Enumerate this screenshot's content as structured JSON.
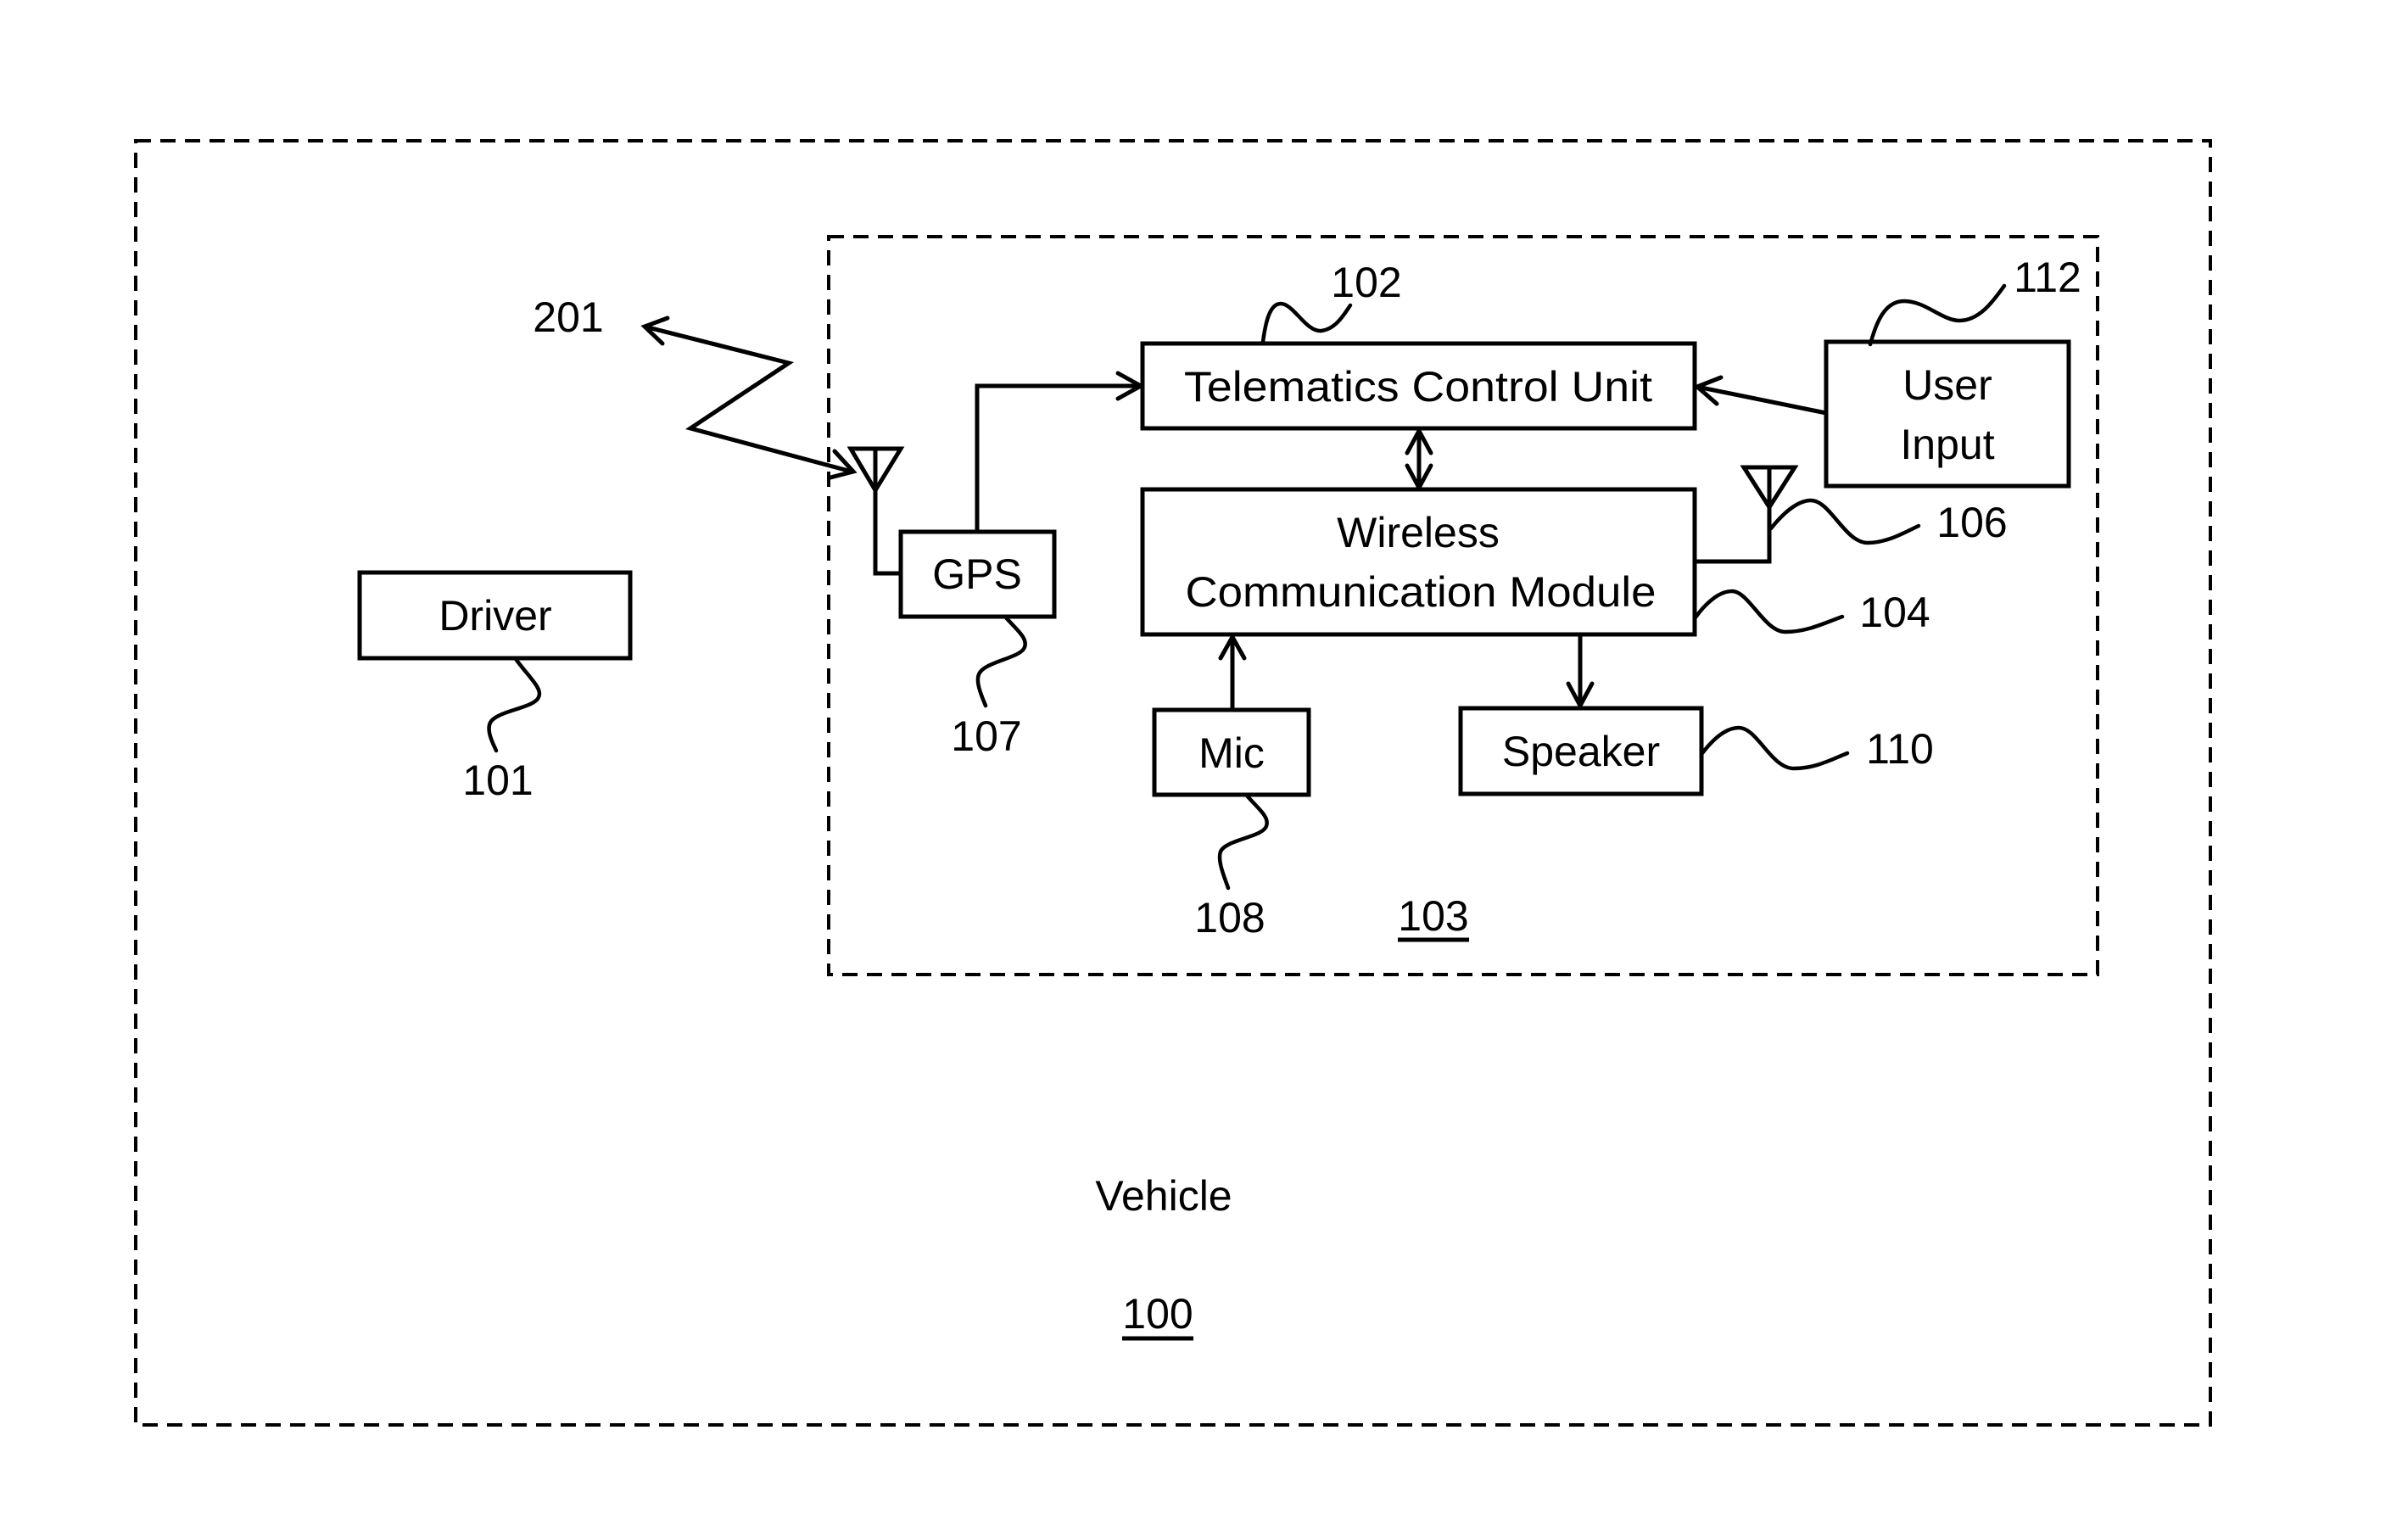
{
  "figure": {
    "type": "patent block diagram",
    "colors": {
      "line": "#000000",
      "background": "#ffffff"
    }
  },
  "containers": {
    "vehicle": {
      "label": "Vehicle",
      "ref": "100",
      "ref_underlined": true
    },
    "telematics_system": {
      "ref": "103",
      "ref_underlined": true
    }
  },
  "blocks": {
    "driver": {
      "lines": [
        "Driver"
      ],
      "ref": "101"
    },
    "tcu": {
      "lines": [
        "Telematics Control Unit"
      ],
      "ref": "102"
    },
    "wcm": {
      "lines": [
        "Wireless",
        "Communication Module"
      ],
      "ref": "104"
    },
    "gps": {
      "lines": [
        "GPS"
      ],
      "ref": "107"
    },
    "mic": {
      "lines": [
        "Mic"
      ],
      "ref": "108"
    },
    "speaker": {
      "lines": [
        "Speaker"
      ],
      "ref": "110"
    },
    "user_input": {
      "lines": [
        "User",
        "Input"
      ],
      "ref": "112"
    }
  },
  "antennas": {
    "gps_antenna": {
      "ref": ""
    },
    "wcm_antenna": {
      "ref": "106"
    }
  },
  "signals": {
    "wireless_link": {
      "ref": "201"
    }
  },
  "connections": [
    {
      "from": "gps",
      "to": "tcu",
      "direction": "one-way"
    },
    {
      "from": "user_input",
      "to": "tcu",
      "direction": "one-way"
    },
    {
      "from": "tcu",
      "to": "wcm",
      "direction": "bidirectional"
    },
    {
      "from": "mic",
      "to": "wcm",
      "direction": "one-way"
    },
    {
      "from": "wcm",
      "to": "speaker",
      "direction": "one-way"
    },
    {
      "from": "gps_antenna",
      "to": "gps",
      "direction": "line"
    },
    {
      "from": "wcm",
      "to": "wcm_antenna",
      "direction": "line"
    },
    {
      "from": "wireless_link",
      "to": "gps_antenna",
      "direction": "bidirectional"
    }
  ]
}
